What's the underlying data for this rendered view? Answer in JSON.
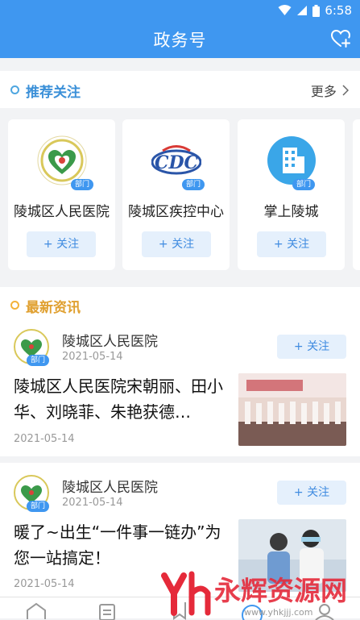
{
  "status_bar": {
    "time": "6:58"
  },
  "app_bar": {
    "title": "政务号"
  },
  "recommended": {
    "title": "推荐关注",
    "more_label": "更多",
    "cards": [
      {
        "name": "陵城区人民医院",
        "badge": "部门",
        "follow_label": "+ 关注"
      },
      {
        "name": "陵城区疾控中心",
        "badge": "部门",
        "follow_label": "+ 关注"
      },
      {
        "name": "掌上陵城",
        "badge": "部门",
        "follow_label": "+ 关注"
      }
    ]
  },
  "news": {
    "title": "最新资讯",
    "items": [
      {
        "source": "陵城区人民医院",
        "source_date": "2021-05-14",
        "badge": "部门",
        "follow_label": "+ 关注",
        "title": "陵城区人民医院宋朝丽、田小华、刘晓菲、朱艳获德…",
        "date": "2021-05-14"
      },
      {
        "source": "陵城区人民医院",
        "source_date": "2021-05-14",
        "badge": "部门",
        "follow_label": "+ 关注",
        "title": "暖了~出生“一件事一链办”为您一站搞定！",
        "date": "2021-05-14"
      }
    ]
  },
  "watermark": {
    "name": "永辉资源网",
    "url": "www.yhkjjj.com"
  },
  "colors": {
    "primary": "#3f97f0",
    "follow_bg": "#e5f0fc",
    "section_ring_blue": "#4ea6e0",
    "section_ring_orange": "#f3b23a"
  }
}
